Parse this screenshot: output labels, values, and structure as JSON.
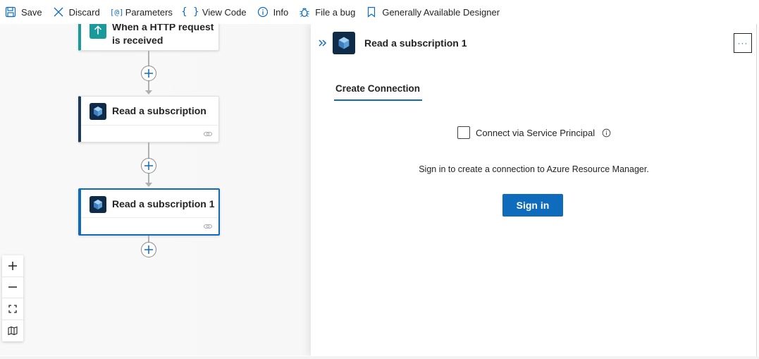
{
  "toolbar": {
    "save_label": "Save",
    "discard_label": "Discard",
    "parameters_label": "Parameters",
    "view_code_label": "View Code",
    "info_label": "Info",
    "file_bug_label": "File a bug",
    "designer_label": "Generally Available Designer",
    "parameters_icon_glyph": "[@]",
    "view_code_icon_glyph": "{ }"
  },
  "canvas": {
    "trigger_card": {
      "title_line1": "When a HTTP request",
      "title_line2": "is received"
    },
    "card_1": {
      "title": "Read a subscription"
    },
    "card_2": {
      "title": "Read a subscription 1"
    }
  },
  "panel": {
    "title": "Read a subscription 1",
    "more_label": "···",
    "tab_label": "Create Connection",
    "service_principal_label": "Connect via Service Principal",
    "service_principal_checked": false,
    "signin_text": "Sign in to create a connection to Azure Resource Manager.",
    "signin_button": "Sign in"
  },
  "colors": {
    "accent": "#0f6cbd",
    "arm_icon_bg": "#0f2b47",
    "trigger_accent": "#1a9a9a"
  },
  "icons": {
    "save": "save-icon",
    "discard": "discard-icon",
    "parameters": "parameters-icon",
    "view_code": "code-icon",
    "info": "info-icon",
    "bug": "bug-icon",
    "designer": "bookmark-icon",
    "zoom_in": "zoom-in-icon",
    "zoom_out": "zoom-out-icon",
    "fit": "fit-view-icon",
    "minimap": "map-icon"
  }
}
